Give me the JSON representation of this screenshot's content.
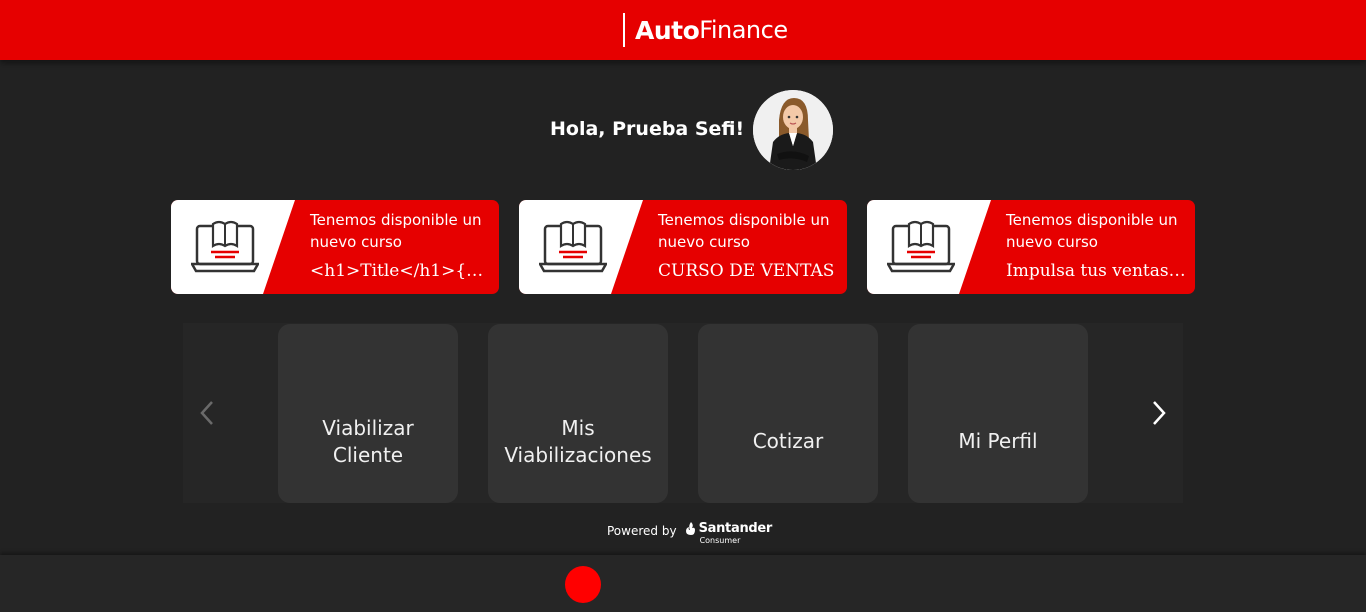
{
  "header": {
    "logo_bold": "Auto",
    "logo_light": "Finance",
    "brand_color": "#e60000"
  },
  "greeting": "Hola, Prueba Sefi!",
  "avatar_icon": "user-avatar-woman",
  "courses": [
    {
      "line1": "Tenemos disponible un nuevo curso",
      "title": "<h1>Title</h1>{{7…",
      "icon": "laptop-book-icon"
    },
    {
      "line1": "Tenemos disponible un nuevo curso",
      "title": "CURSO DE VENTAS",
      "icon": "laptop-book-icon"
    },
    {
      "line1": "Tenemos disponible un nuevo curso",
      "title": "Impulsa tus ventas …",
      "icon": "laptop-book-icon"
    }
  ],
  "menu": [
    {
      "label": "Viabilizar Cliente"
    },
    {
      "label": "Mis Viabilizaciones"
    },
    {
      "label": "Cotizar"
    },
    {
      "label": "Mi Perfil"
    }
  ],
  "nav": {
    "prev_icon": "chevron-left-icon",
    "next_icon": "chevron-right-icon"
  },
  "footer": {
    "powered_by": "Powered by",
    "brand": "Santander",
    "brand_sub": "Consumer"
  }
}
